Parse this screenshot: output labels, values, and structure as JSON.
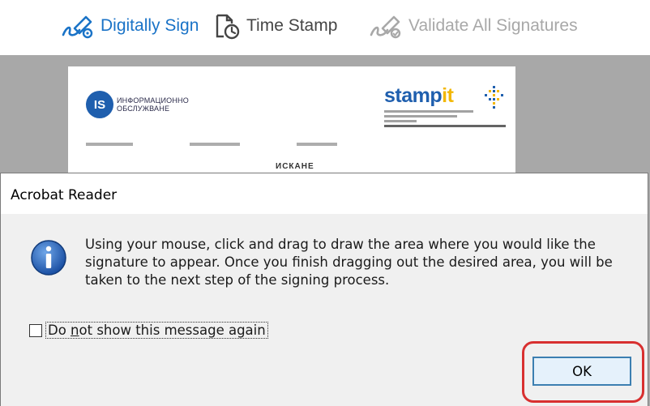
{
  "toolbar": {
    "digitally_sign_label": "Digitally Sign",
    "time_stamp_label": "Time Stamp",
    "validate_label": "Validate All Signatures",
    "accent_color": "#1a73c7",
    "disabled_color": "#a8a8a8",
    "icons": [
      "pen-signature-icon",
      "clock-document-icon",
      "pen-check-icon"
    ]
  },
  "document": {
    "logo_left_text": "ИНФОРМАЦИОННО\nОБСЛУЖВАНЕ",
    "logo_right_text": "stampit",
    "heading": "ИСКАНЕ"
  },
  "dialog": {
    "title": "Acrobat Reader",
    "message": "Using your mouse, click and drag to draw the area where you would like the signature to appear. Once you finish dragging out the desired area, you will be taken to the next step of the signing process.",
    "checkbox_label_prefix": "Do ",
    "checkbox_label_accel": "n",
    "checkbox_label_suffix": "ot show this message again",
    "checkbox_checked": false,
    "ok_label": "OK",
    "info_icon": "info-icon",
    "highlight_color": "#d83030"
  }
}
